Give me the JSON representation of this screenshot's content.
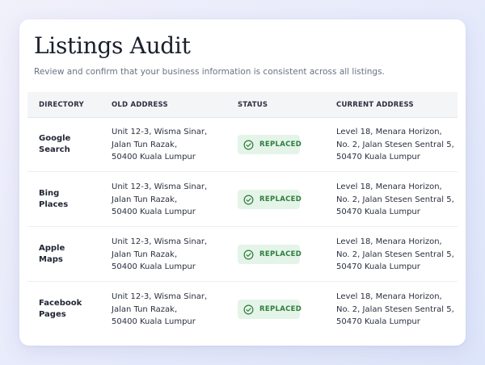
{
  "page": {
    "title": "Listings Audit",
    "subtitle": "Review and confirm that your business information is consistent across all listings."
  },
  "table": {
    "headers": [
      "DIRECTORY",
      "OLD ADDRESS",
      "STATUS",
      "CURRENT ADDRESS"
    ],
    "rows": [
      {
        "directory": "Google\nSearch",
        "old_address": "Unit 12-3, Wisma Sinar,\nJalan Tun Razak,\n50400 Kuala Lumpur",
        "status": "REPLACED",
        "current_address": "Level 18, Menara Horizon,\nNo. 2, Jalan Stesen Sentral 5,\n50470 Kuala Lumpur"
      },
      {
        "directory": "Bing\nPlaces",
        "old_address": "Unit 12-3, Wisma Sinar,\nJalan Tun Razak,\n50400 Kuala Lumpur",
        "status": "REPLACED",
        "current_address": "Level 18, Menara Horizon,\nNo. 2, Jalan Stesen Sentral 5,\n50470 Kuala Lumpur"
      },
      {
        "directory": "Apple\nMaps",
        "old_address": "Unit 12-3, Wisma Sinar,\nJalan Tun Razak,\n50400 Kuala Lumpur",
        "status": "REPLACED",
        "current_address": "Level 18, Menara Horizon,\nNo. 2, Jalan Stesen Sentral 5,\n50470 Kuala Lumpur"
      },
      {
        "directory": "Facebook\nPages",
        "old_address": "Unit 12-3, Wisma Sinar,\nJalan Tun Razak,\n50400 Kuala Lumpur",
        "status": "REPLACED",
        "current_address": "Level 18, Menara Horizon,\nNo. 2, Jalan Stesen Sentral 5,\n50470 Kuala Lumpur"
      }
    ]
  },
  "colors": {
    "status_bg": "#e5f4e8",
    "status_text": "#2e7d3e"
  },
  "icons": {
    "status": "check-circle-icon"
  }
}
